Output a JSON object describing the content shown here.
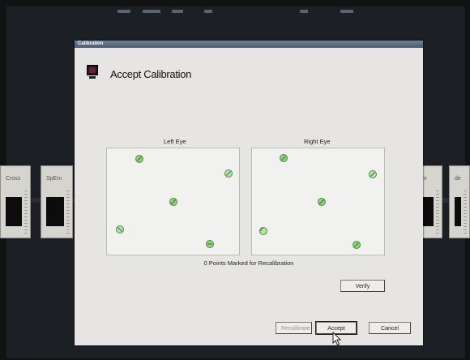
{
  "window": {
    "title": "Calibration",
    "heading": "Accept Calibration"
  },
  "panels": {
    "left": {
      "label": "Left Eye"
    },
    "right": {
      "label": "Right Eye"
    }
  },
  "status": {
    "marked_text": "0 Points Marked for Recalibration"
  },
  "buttons": {
    "verify": "Verify",
    "recalibrate": "Recalibrate",
    "accept": "Accept",
    "cancel": "Cancel"
  },
  "background": {
    "slides": [
      "Cross",
      "SpEm",
      "ghr",
      "de"
    ]
  },
  "colors": {
    "titlebar": "#4b5d75",
    "dialog_bg": "#e6e5e3",
    "point_fill": "#8fd07a",
    "point_stroke": "#4f8f45"
  },
  "icons": {
    "app": "monitor-icon",
    "pointer": "mouse-pointer-icon"
  }
}
